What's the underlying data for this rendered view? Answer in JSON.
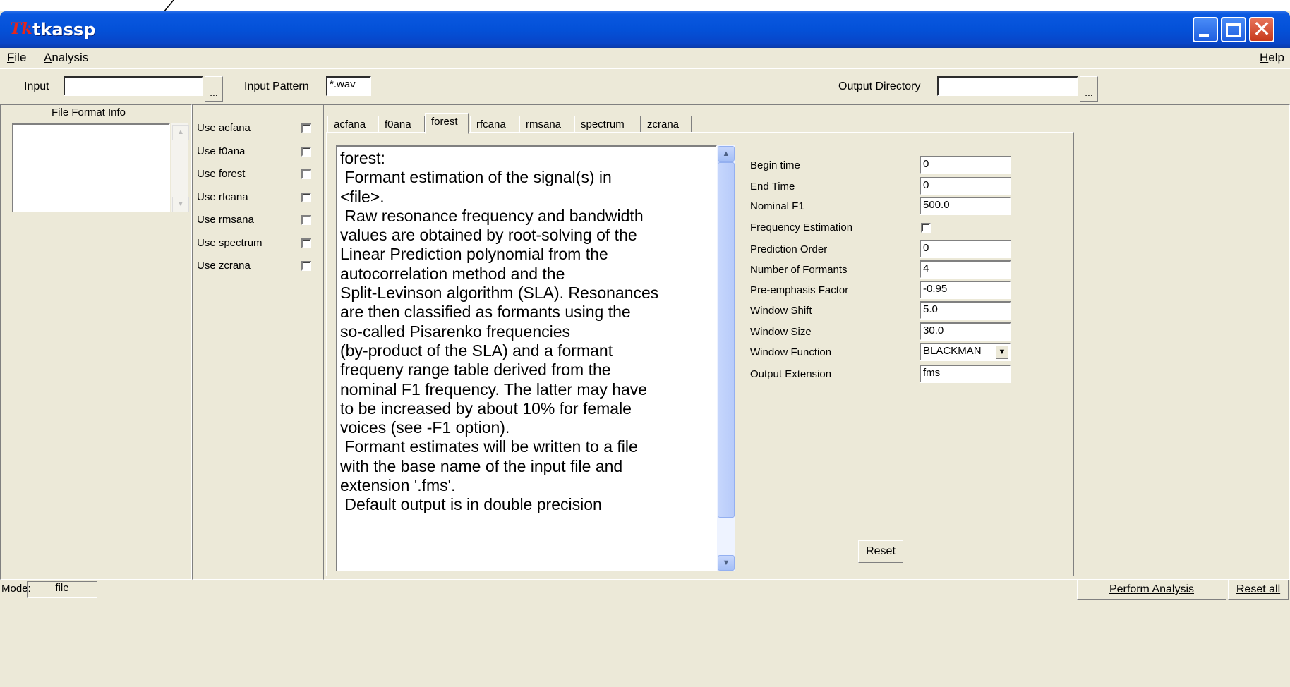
{
  "window": {
    "title": "tkassp",
    "logo_text": "Tk",
    "minimize_icon": "minimize-icon",
    "maximize_icon": "maximize-icon",
    "close_icon": "close-icon",
    "close_glyph": "✕"
  },
  "menubar": {
    "file": "File",
    "analysis": "Analysis",
    "help": "Help"
  },
  "toolbar": {
    "input_label": "Input",
    "input_value": "",
    "input_browse": "...",
    "pattern_label": "Input Pattern",
    "pattern_value": "*.wav",
    "output_label": "Output Directory",
    "output_value": "",
    "output_browse": "..."
  },
  "file_info": {
    "title": "File Format Info",
    "up_arrow": "▲",
    "down_arrow": "▼"
  },
  "analyses": [
    {
      "label": "Use acfana",
      "checked": false
    },
    {
      "label": "Use f0ana",
      "checked": false
    },
    {
      "label": "Use forest",
      "checked": false
    },
    {
      "label": "Use rfcana",
      "checked": false
    },
    {
      "label": "Use rmsana",
      "checked": false
    },
    {
      "label": "Use spectrum",
      "checked": false
    },
    {
      "label": "Use zcrana",
      "checked": false
    }
  ],
  "tabs": [
    {
      "label": "acfana",
      "active": false
    },
    {
      "label": "f0ana",
      "active": false
    },
    {
      "label": "forest",
      "active": true
    },
    {
      "label": "rfcana",
      "active": false
    },
    {
      "label": "rmsana",
      "active": false
    },
    {
      "label": "spectrum",
      "active": false
    },
    {
      "label": "zcrana",
      "active": false
    }
  ],
  "description_lines": [
    "forest:",
    " Formant estimation of the signal(s) in",
    "<file>.",
    " Raw resonance frequency and bandwidth",
    "values are obtained by root-solving of the",
    "Linear Prediction polynomial from the",
    "autocorrelation method and the",
    "Split-Levinson algorithm (SLA). Resonances",
    "are then classified as formants using the",
    "so-called Pisarenko frequencies",
    "(by-product of the SLA) and a formant",
    "frequeny range table derived from the",
    "nominal F1 frequency. The latter may have",
    "to be increased by about 10% for female",
    "voices (see -F1 option).",
    " Formant estimates will be written to a file",
    "with the base name of the input file and",
    "extension '.fms'.",
    " Default output is in double precision"
  ],
  "params": {
    "begin_time": {
      "label": "Begin time",
      "value": "0"
    },
    "end_time": {
      "label": "End Time",
      "value": "0"
    },
    "nominal_f1": {
      "label": "Nominal F1",
      "value": "500.0"
    },
    "freq_est": {
      "label": "Frequency Estimation",
      "checked": false
    },
    "pred_order": {
      "label": "Prediction Order",
      "value": "0"
    },
    "num_formants": {
      "label": "Number of Formants",
      "value": "4"
    },
    "preemph": {
      "label": "Pre-emphasis Factor",
      "value": "-0.95"
    },
    "win_shift": {
      "label": "Window Shift",
      "value": "5.0"
    },
    "win_size": {
      "label": "Window Size",
      "value": "30.0"
    },
    "win_func": {
      "label": "Window Function",
      "value": "BLACKMAN",
      "arrow": "▼"
    },
    "out_ext": {
      "label": "Output Extension",
      "value": "fms"
    }
  },
  "reset_label": "Reset",
  "status": {
    "mode_label": "Mode:",
    "mode_value": "file",
    "perform_label": "Perform Analysis",
    "reset_all_label": "Reset all"
  }
}
